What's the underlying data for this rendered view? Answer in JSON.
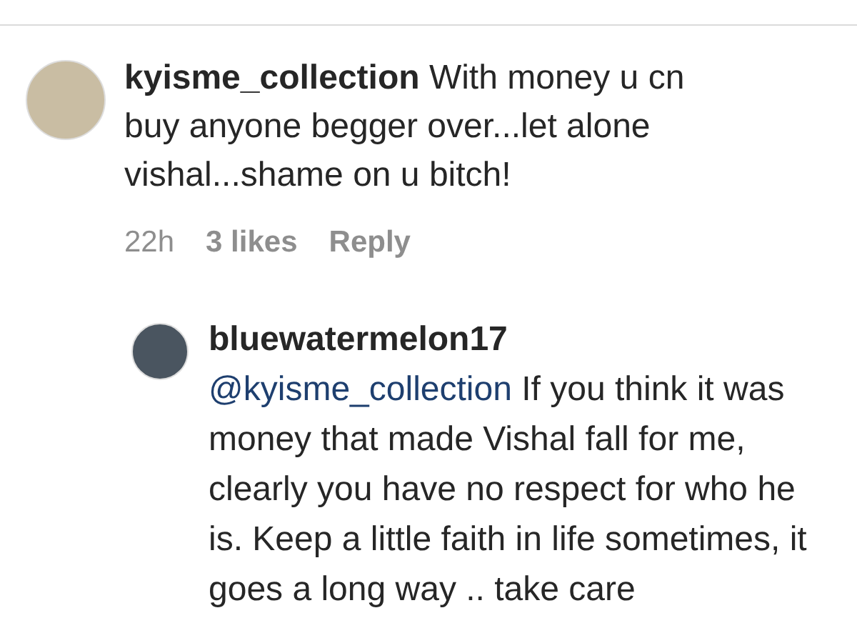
{
  "comments": [
    {
      "username": "kyisme_collection",
      "text": "With money u cn buy anyone begger over...let alone vishal...shame on u bitch!",
      "time": "22h",
      "likes": "3 likes",
      "reply_label": "Reply",
      "replies": [
        {
          "username": "bluewatermelon17",
          "mention": "@kyisme_collection",
          "text": "If you think it was money that made Vishal fall for me, clearly you have no respect for who he is. Keep a little faith in life sometimes, it goes a long way .. take care"
        }
      ]
    }
  ]
}
